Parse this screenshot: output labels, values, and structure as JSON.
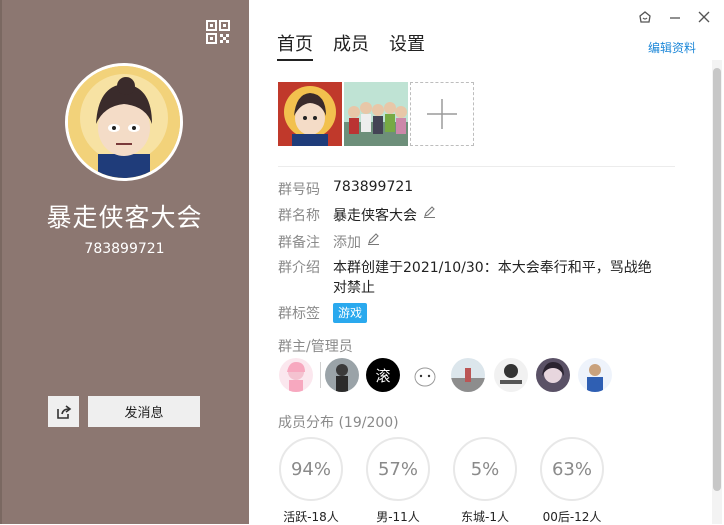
{
  "left_panel": {
    "group_name": "暴走侠客大会",
    "group_id": "783899721",
    "send_message_label": "发消息"
  },
  "window_controls": [
    "skin-icon",
    "minimize-icon",
    "close-icon"
  ],
  "tabs": [
    {
      "label": "首页",
      "active": true
    },
    {
      "label": "成员",
      "active": false
    },
    {
      "label": "设置",
      "active": false
    }
  ],
  "edit_profile_label": "编辑资料",
  "info": {
    "group_number": {
      "label": "群号码",
      "value": "783899721"
    },
    "group_name": {
      "label": "群名称",
      "value": "暴走侠客大会"
    },
    "group_remark": {
      "label": "群备注",
      "value": "添加"
    },
    "group_intro": {
      "label": "群介绍",
      "line1": "本群创建于2021/10/30：本大会奉行和平，骂战绝",
      "line2": "对禁止"
    },
    "group_tag": {
      "label": "群标签",
      "value": "游戏"
    }
  },
  "admins_title": "群主/管理员",
  "admin_badge_text": "滚",
  "member_dist_title": "成员分布 (19/200)",
  "stats": [
    {
      "value": "94%",
      "label": "活跃-18人"
    },
    {
      "value": "57%",
      "label": "男-11人"
    },
    {
      "value": "5%",
      "label": "东城-1人"
    },
    {
      "value": "63%",
      "label": "00后-12人"
    }
  ],
  "colors": {
    "left_bg": "#8c7771",
    "accent": "#1e88d8",
    "tag_bg": "#2aa9ee"
  }
}
